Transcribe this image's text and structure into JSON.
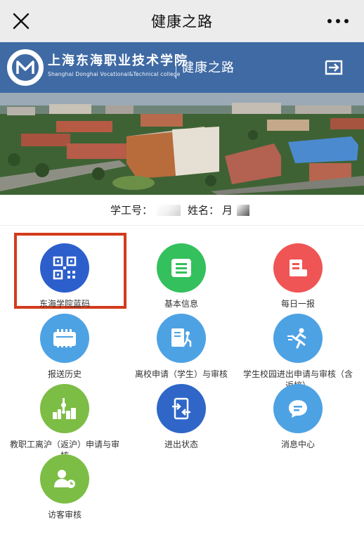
{
  "topbar": {
    "title": "健康之路",
    "close_icon": "close-icon",
    "more_icon": "more-dots-icon"
  },
  "header": {
    "college_cn": "上海东海职业技术学院",
    "college_en": "Shanghai Donghai Vocational&Technical college",
    "section": "健康之路",
    "logo_letter": "M",
    "logout_icon": "logout-icon"
  },
  "student": {
    "id_label": "学工号：",
    "name_label": "姓名：",
    "name_partial": "月"
  },
  "menu": [
    {
      "label": "东海学院蓝码",
      "icon": "qr-code-icon",
      "color": "#2d5fcc"
    },
    {
      "label": "基本信息",
      "icon": "info-card-icon",
      "color": "#34c05c"
    },
    {
      "label": "每日一报",
      "icon": "daily-report-icon",
      "color": "#ef5555"
    },
    {
      "label": "报送历史",
      "icon": "history-icon",
      "color": "#4da2e4"
    },
    {
      "label": "离校申请（学生）与审核",
      "icon": "leave-school-icon",
      "color": "#4da2e4"
    },
    {
      "label": "学生校园进出申请与审核（含返校）",
      "icon": "running-person-icon",
      "color": "#4da2e4"
    },
    {
      "label": "教职工离沪（返沪）申请与审核",
      "icon": "city-skyline-icon",
      "color": "#7cbd45"
    },
    {
      "label": "进出状态",
      "icon": "entry-exit-icon",
      "color": "#2f66c8"
    },
    {
      "label": "消息中心",
      "icon": "message-icon",
      "color": "#4da2e4"
    },
    {
      "label": "访客审核",
      "icon": "visitor-icon",
      "color": "#7cbd45"
    }
  ],
  "colors": {
    "header_blue": "#3f6aa4",
    "highlight_red": "#d33b1c",
    "topbar_gray": "#ececec"
  }
}
